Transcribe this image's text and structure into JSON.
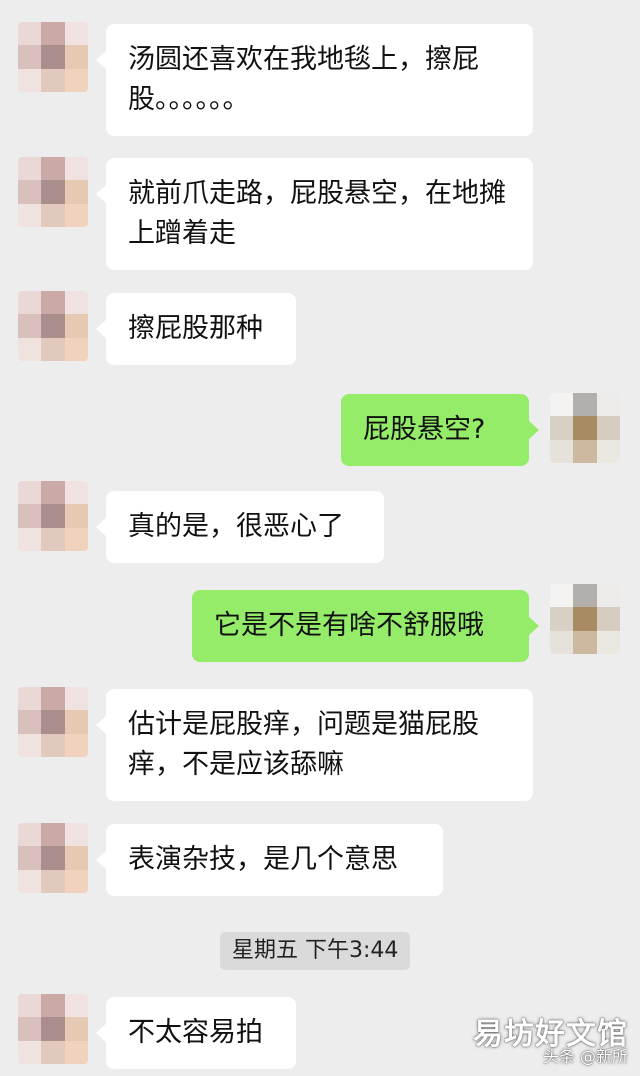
{
  "messages": [
    {
      "side": "in",
      "text": "汤圆还喜欢在我地毯上，擦屁股。。。。。。"
    },
    {
      "side": "in",
      "text": "就前爪走路，屁股悬空，在地摊上蹭着走"
    },
    {
      "side": "in",
      "text": "擦屁股那种"
    },
    {
      "side": "out",
      "text": "屁股悬空?"
    },
    {
      "side": "in",
      "text": "真的是，很恶心了"
    },
    {
      "side": "out",
      "text": "它是不是有啥不舒服哦"
    },
    {
      "side": "in",
      "text": "估计是屁股痒，问题是猫屁股痒，不是应该舔嘛"
    },
    {
      "side": "in",
      "text": "表演杂技，是几个意思"
    },
    {
      "side": "in",
      "text": "不太容易拍"
    }
  ],
  "timestamp": "星期五 下午3:44",
  "watermark": {
    "title": "易坊好文馆",
    "subtitle": "头条 @新所"
  },
  "colors": {
    "background": "#ededed",
    "incoming_bubble": "#ffffff",
    "outgoing_bubble": "#95ec69",
    "timestamp_pill": "#dadada"
  },
  "avatars": {
    "contact": [
      "#ead8d6",
      "#caa9a6",
      "#f0e2e0",
      "#d9c0bc",
      "#a98e8c",
      "#e6c9b3",
      "#efe2df",
      "#e2c9be",
      "#f1d2bd"
    ],
    "self": [
      "#f4f3f1",
      "#b3afac",
      "#ecebe9",
      "#d8d0c4",
      "#a88b62",
      "#d6ccbf",
      "#e6e1da",
      "#cdb8a0",
      "#ebe7e1"
    ]
  }
}
